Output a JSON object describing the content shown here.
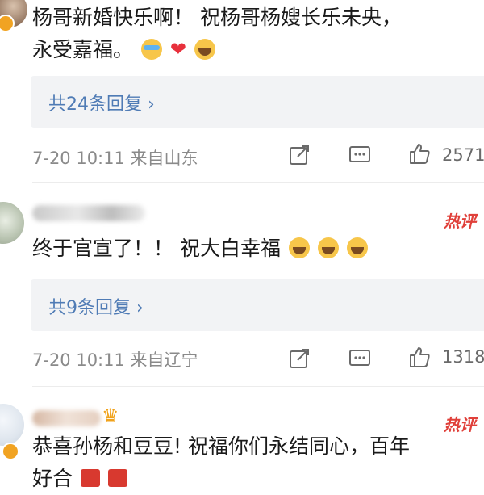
{
  "comments": [
    {
      "text_line1": "杨哥新婚快乐啊！ 祝杨哥杨嫂长乐未央，",
      "text_line2": "永受嘉福。",
      "emojis": [
        "laugh-cry-emoji",
        "heart-emoji",
        "tears-emoji"
      ],
      "replies": "共24条回复 ›",
      "time": "7-20 10:11",
      "location": "来自山东",
      "likes": "2571"
    },
    {
      "hot_tag": "热评",
      "text": "终于官宣了！！ 祝大白幸福",
      "emojis": [
        "crying-emoji",
        "crying-emoji",
        "crying-emoji"
      ],
      "replies": "共9条回复 ›",
      "time": "7-20 10:11",
      "location": "来自辽宁",
      "likes": "1318"
    },
    {
      "hot_tag": "热评",
      "text_line1": "恭喜孙杨和豆豆! 祝福你们永结同心，百年",
      "text_line2": "好合",
      "emojis": [
        "gift-emoji",
        "gift-emoji"
      ]
    }
  ],
  "colors": {
    "link": "#4f7bb5",
    "hot": "#e0403a",
    "meta": "#8a8a8a",
    "reply_bg": "#f2f3f5"
  },
  "icons": [
    "share-icon",
    "comment-icon",
    "like-icon",
    "crown-icon",
    "verified-badge-icon"
  ]
}
